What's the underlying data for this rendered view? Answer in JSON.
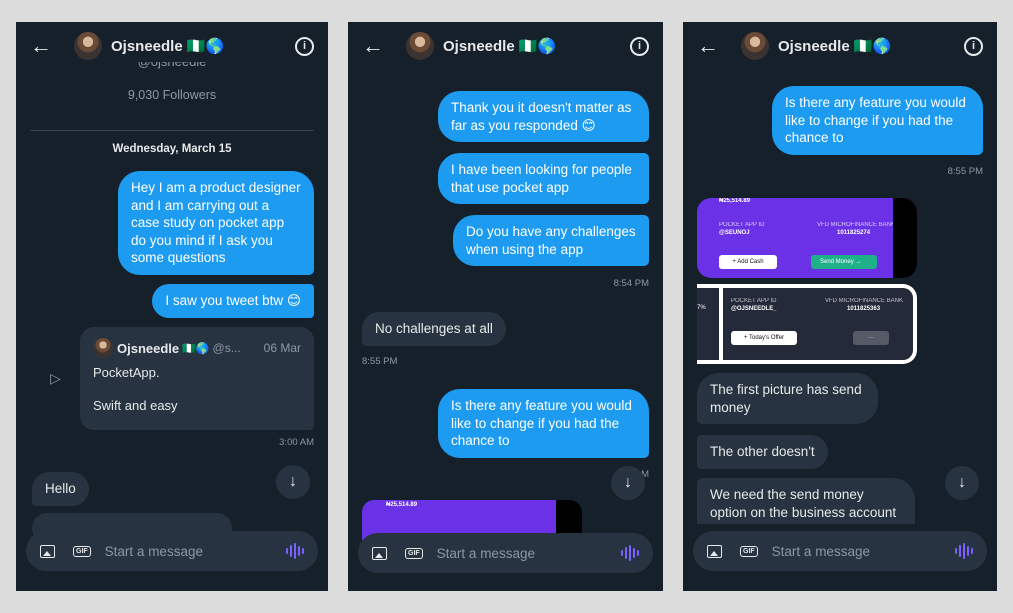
{
  "header": {
    "name": "Ojsneedle",
    "flags": "🇳🇬🌎"
  },
  "composer": {
    "placeholder": "Start a message",
    "gif_label": "GIF"
  },
  "panel1": {
    "handle_partial": "@ojsneedle",
    "followers": "9,030 Followers",
    "date": "Wednesday, March 15",
    "msg1": "Hey I am a product designer and I am carrying out a case study on pocket app do you mind if I ask you some questions",
    "msg2": "I saw you tweet btw 😊",
    "tweet": {
      "name": "Ojsneedle",
      "handle": "@s...",
      "date": "06 Mar",
      "line1": "PocketApp.",
      "line2": "Swift and easy"
    },
    "time1": "3:00 AM",
    "msg3": "Hello"
  },
  "panel2": {
    "msg1": "Thank you it doesn't matter as far as you responded 😊",
    "msg2": "I have been looking for people that use pocket app",
    "msg3": "Do you have any challenges when using the app",
    "time1": "8:54 PM",
    "msg4": "No challenges at all",
    "time2": "8:55 PM",
    "msg5": "Is there any feature you would like to change if you had the chance to",
    "time3_partial": "M",
    "card_amount": "₦25,514.89"
  },
  "panel3": {
    "msg1": "Is there any feature you would like to change if you had the chance to",
    "time1": "8:55 PM",
    "card1": {
      "amount": "₦25,514.89",
      "id_label": "POCKET APP ID",
      "id": "@SEUNOJ",
      "bank": "VFD MICROFINANCE BANK",
      "acct": "1011825274",
      "btn1": "+ Add Cash",
      "btn2": "Send Money →"
    },
    "card2": {
      "id_label": "POCKET APP ID",
      "id": "@OJSNEEDLE_",
      "bank": "VFD MICROFINANCE BANK",
      "acct": "1011825363",
      "btn1": "+ Today's Offer",
      "btn2": "···",
      "side": "7%"
    },
    "msg2": "The first picture has send money",
    "msg3": "The other doesn't",
    "msg4": "We need the send money option on the business account"
  }
}
